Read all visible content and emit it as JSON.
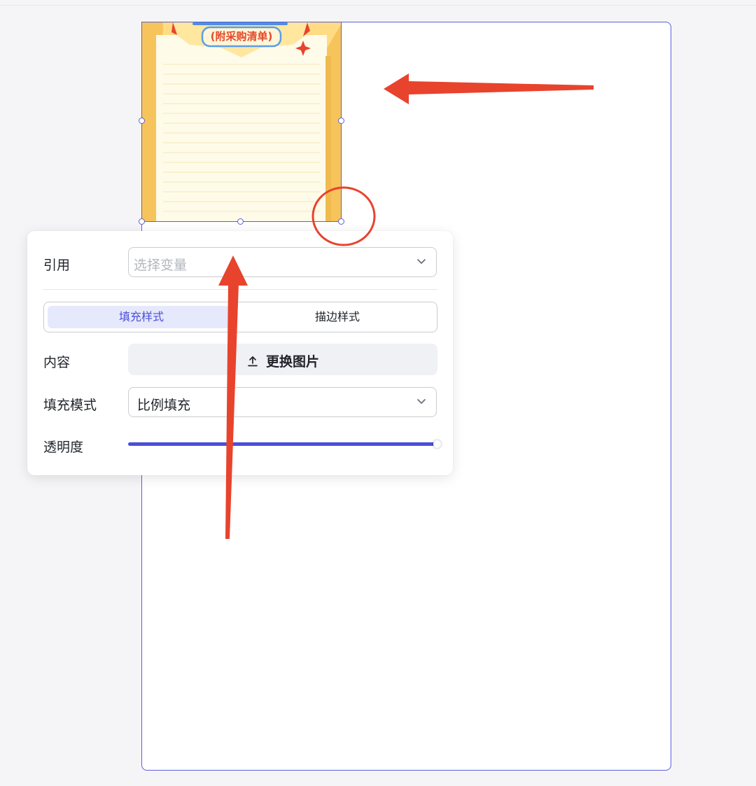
{
  "canvas": {
    "template_subtitle": "(附采购清单)"
  },
  "panel": {
    "reference": {
      "label": "引用",
      "placeholder": "选择变量",
      "chevron_icon": "chevron-down-icon"
    },
    "tabs": [
      {
        "label": "填充样式",
        "active": true
      },
      {
        "label": "描边样式",
        "active": false
      }
    ],
    "content": {
      "label": "内容",
      "button_label": "更换图片",
      "button_icon": "upload-icon"
    },
    "fill_mode": {
      "label": "填充模式",
      "value": "比例填充",
      "chevron_icon": "chevron-down-icon"
    },
    "opacity": {
      "label": "透明度",
      "value_percent": 100
    }
  },
  "colors": {
    "accent": "#4b4fd8",
    "annotation": "#e8432d",
    "selection": "#5b5fe0",
    "template_yellow": "#ffdb83"
  }
}
